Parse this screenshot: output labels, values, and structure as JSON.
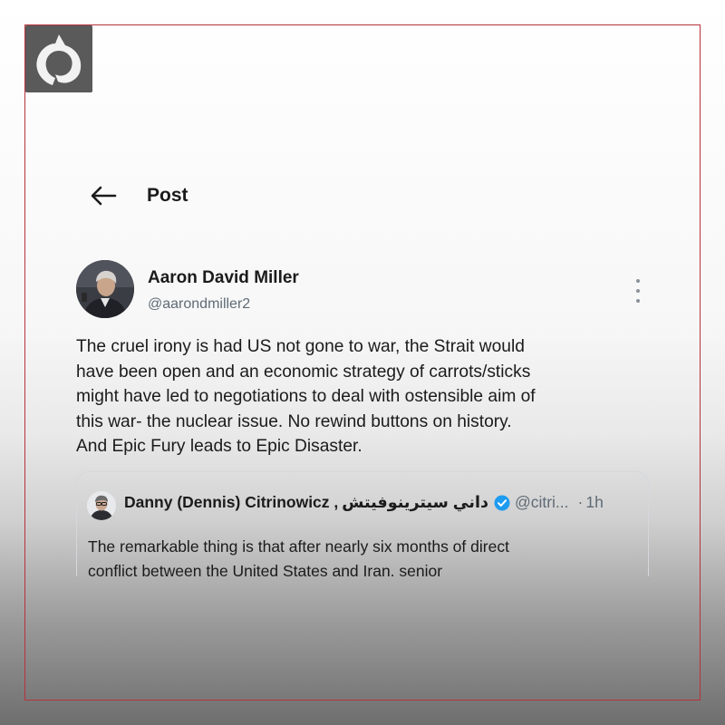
{
  "header": {
    "title": "Post"
  },
  "author": {
    "name": "Aaron David Miller",
    "handle": "@aarondmiller2"
  },
  "post": {
    "lines": [
      "The cruel irony is had US  not gone to war, the Strait would",
      "have been open and an economic strategy of carrots/sticks",
      "might have led to negotiations to deal with ostensible aim of",
      "this war- the nuclear issue. No rewind buttons on history.",
      "And Epic Fury leads to Epic Disaster."
    ]
  },
  "quote": {
    "name": "Danny (Dennis) Citrinowicz ,",
    "name_arabic": "داني سيترينوفيتش",
    "handle": "@citri...",
    "separator": "·",
    "time": "1h",
    "lines": [
      "The remarkable thing is that after nearly six months of direct",
      "conflict between the United States and Iran, senior"
    ]
  },
  "icons": {
    "back": "arrow-left-icon",
    "more": "more-vertical-icon",
    "verified": "verified-badge-icon",
    "logo": "channel-logo"
  },
  "colors": {
    "text": "#1b1b1b",
    "secondary": "#5f6b76",
    "verified": "#1d9bf0",
    "frame": "#b8343b"
  }
}
